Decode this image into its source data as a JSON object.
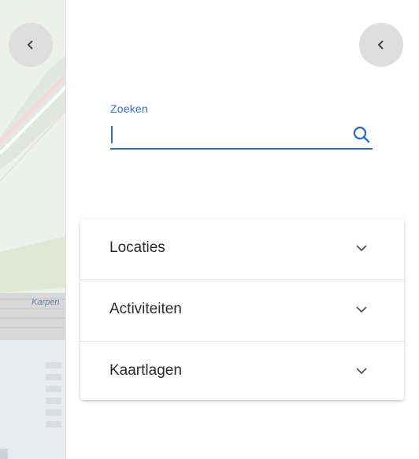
{
  "map": {
    "place_label": "Karpen"
  },
  "nav": {
    "collapse_left_icon": "chevron-left-icon",
    "collapse_right_icon": "chevron-left-icon"
  },
  "search": {
    "label": "Zoeken",
    "value": "",
    "placeholder": "",
    "icon": "search-icon"
  },
  "panel": {
    "items": [
      {
        "label": "Locaties",
        "icon": "chevron-down-icon"
      },
      {
        "label": "Activiteiten",
        "icon": "chevron-down-icon"
      },
      {
        "label": "Kaartlagen",
        "icon": "chevron-down-icon"
      }
    ]
  },
  "colors": {
    "accent": "#2f6fc8",
    "button_bg": "#dedede",
    "map_bg": "#eef0ec"
  }
}
